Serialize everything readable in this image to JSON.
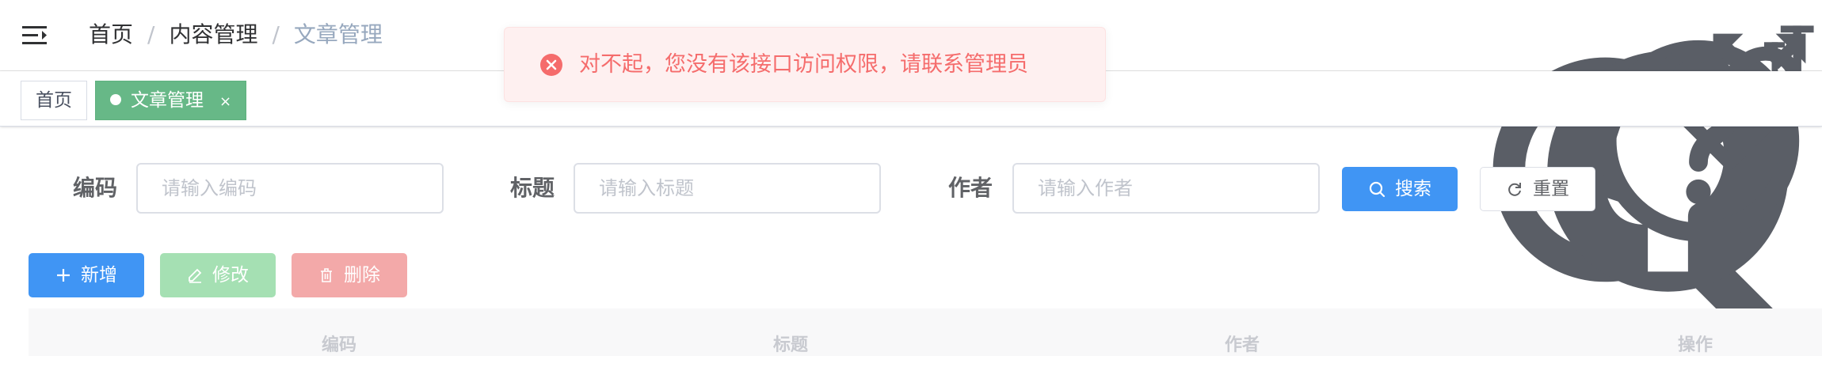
{
  "breadcrumb": [
    "首页",
    "内容管理",
    "文章管理"
  ],
  "breadcrumb_separator": "/",
  "right_menu_icons": [
    "search-icon",
    "github-icon",
    "question-icon",
    "heart-icon",
    "fullscreen-icon",
    "font-size-icon"
  ],
  "tags": [
    {
      "label": "首页",
      "active": false
    },
    {
      "label": "文章管理",
      "active": true,
      "close": "×"
    }
  ],
  "alert": {
    "type": "error",
    "message": "对不起，您没有该接口访问权限，请联系管理员",
    "color": "#f56c6c"
  },
  "search_form": {
    "code_label": "编码",
    "code_placeholder": "请输入编码",
    "title_label": "标题",
    "title_placeholder": "请输入标题",
    "author_label": "作者",
    "author_placeholder": "请输入作者",
    "search_button": "搜索",
    "reset_button": "重置"
  },
  "toolbar": {
    "add": "新增",
    "edit": "修改",
    "delete": "删除"
  },
  "table": {
    "columns": [
      "编码",
      "标题",
      "作者",
      "操作"
    ]
  },
  "colors": {
    "primary": "#4095f4",
    "active_tag": "#67b887",
    "error": "#f56c6c"
  }
}
